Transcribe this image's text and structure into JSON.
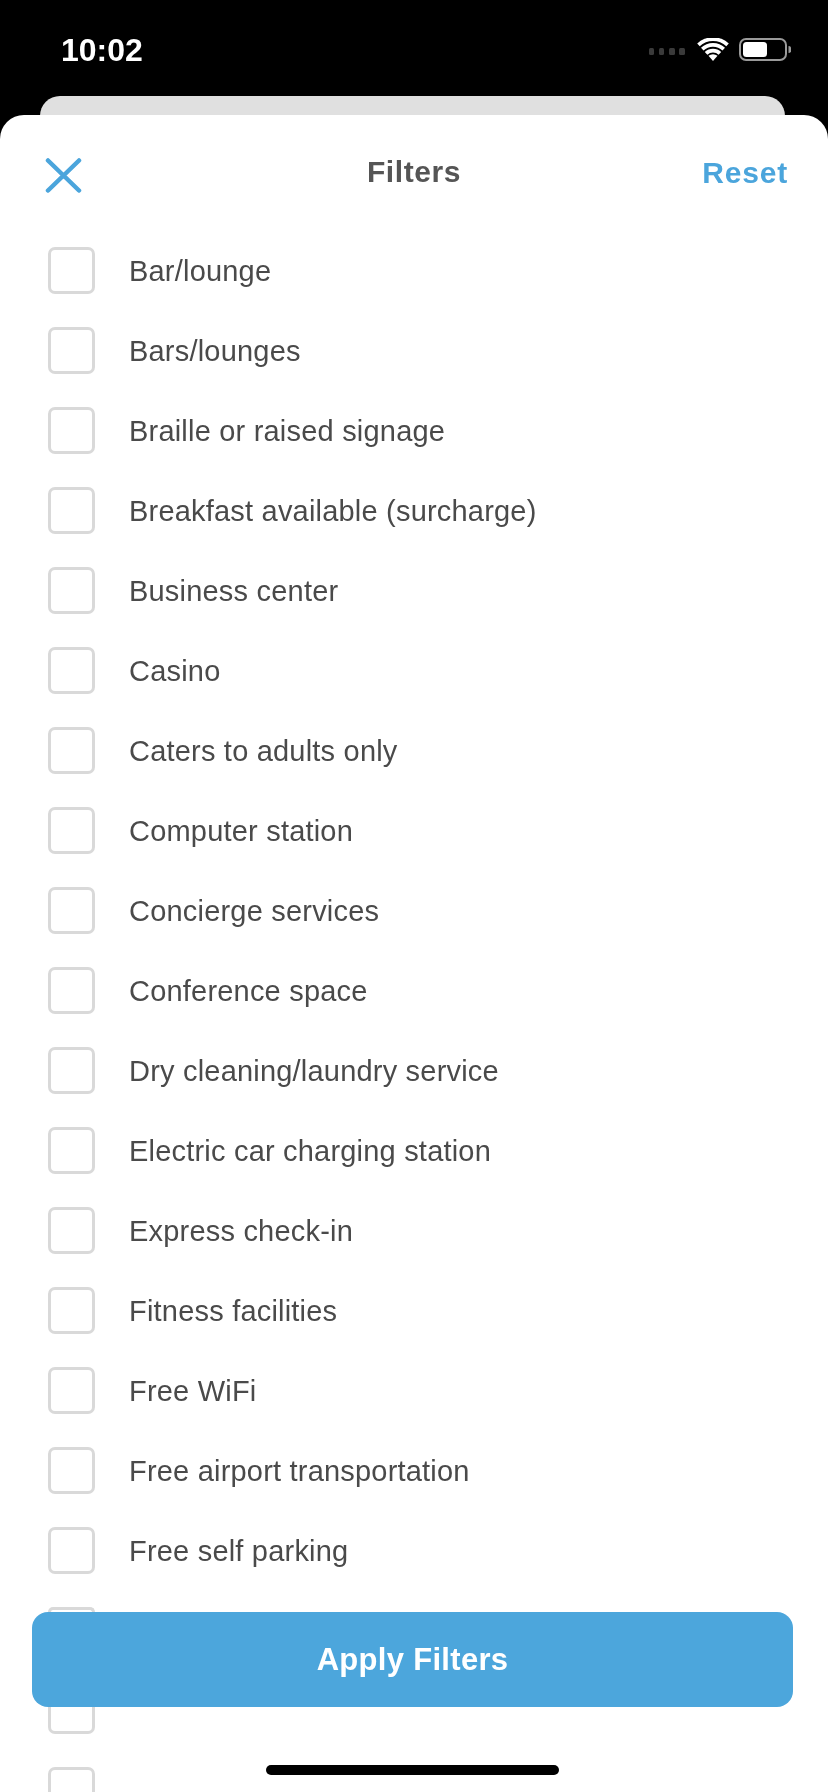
{
  "status_bar": {
    "time": "10:02"
  },
  "header": {
    "title": "Filters",
    "reset_label": "Reset"
  },
  "filters": [
    {
      "label": "Bar/lounge",
      "checked": false
    },
    {
      "label": "Bars/lounges",
      "checked": false
    },
    {
      "label": "Braille or raised signage",
      "checked": false
    },
    {
      "label": "Breakfast available (surcharge)",
      "checked": false
    },
    {
      "label": "Business center",
      "checked": false
    },
    {
      "label": "Casino",
      "checked": false
    },
    {
      "label": "Caters to adults only",
      "checked": false
    },
    {
      "label": "Computer station",
      "checked": false
    },
    {
      "label": "Concierge services",
      "checked": false
    },
    {
      "label": "Conference space",
      "checked": false
    },
    {
      "label": "Dry cleaning/laundry service",
      "checked": false
    },
    {
      "label": "Electric car charging station",
      "checked": false
    },
    {
      "label": "Express check-in",
      "checked": false
    },
    {
      "label": "Fitness facilities",
      "checked": false
    },
    {
      "label": "Free WiFi",
      "checked": false
    },
    {
      "label": "Free airport transportation",
      "checked": false
    },
    {
      "label": "Free self parking",
      "checked": false
    },
    {
      "checked": false
    },
    {
      "checked": false
    },
    {
      "checked": false
    }
  ],
  "apply_button": {
    "label": "Apply Filters"
  }
}
